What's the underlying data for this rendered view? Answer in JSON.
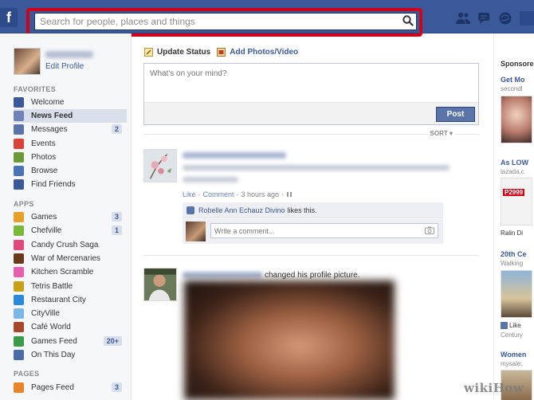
{
  "header": {
    "logo": "f",
    "search": {
      "placeholder": "Search for people, places and things",
      "value": ""
    },
    "highlight_color": "#d0021b",
    "brand_color": "#3b5998",
    "jewels": [
      "friend-requests-icon",
      "messages-icon",
      "notifications-icon"
    ]
  },
  "sidebar": {
    "edit_profile": "Edit Profile",
    "favorites_title": "FAVORITES",
    "favorites": [
      {
        "label": "Welcome",
        "icon": "facebook-icon",
        "count": ""
      },
      {
        "label": "News Feed",
        "icon": "news-feed-icon",
        "count": "",
        "active": true
      },
      {
        "label": "Messages",
        "icon": "messages-icon",
        "count": "2"
      },
      {
        "label": "Events",
        "icon": "events-icon",
        "count": ""
      },
      {
        "label": "Photos",
        "icon": "photos-icon",
        "count": ""
      },
      {
        "label": "Browse",
        "icon": "browse-icon",
        "count": ""
      },
      {
        "label": "Find Friends",
        "icon": "find-friends-icon",
        "count": ""
      }
    ],
    "apps_title": "APPS",
    "apps": [
      {
        "label": "Games",
        "icon": "games-icon",
        "count": "3"
      },
      {
        "label": "Chefville",
        "icon": "chefville-icon",
        "count": "1"
      },
      {
        "label": "Candy Crush Saga",
        "icon": "candy-crush-icon",
        "count": ""
      },
      {
        "label": "War of Mercenaries",
        "icon": "war-of-mercenaries-icon",
        "count": ""
      },
      {
        "label": "Kitchen Scramble",
        "icon": "kitchen-scramble-icon",
        "count": ""
      },
      {
        "label": "Tetris Battle",
        "icon": "tetris-battle-icon",
        "count": ""
      },
      {
        "label": "Restaurant City",
        "icon": "restaurant-city-icon",
        "count": ""
      },
      {
        "label": "CityVille",
        "icon": "cityville-icon",
        "count": ""
      },
      {
        "label": "Café World",
        "icon": "cafe-world-icon",
        "count": ""
      },
      {
        "label": "Games Feed",
        "icon": "games-feed-icon",
        "count": "20+"
      },
      {
        "label": "On This Day",
        "icon": "on-this-day-icon",
        "count": ""
      }
    ],
    "pages_title": "PAGES",
    "pages": [
      {
        "label": "Pages Feed",
        "icon": "pages-feed-icon",
        "count": "3"
      }
    ]
  },
  "composer": {
    "update_status": "Update Status",
    "add_photos": "Add Photos/Video",
    "placeholder": "What's on your mind?",
    "post_label": "Post"
  },
  "feed": {
    "sort_label": "SORT ▾",
    "post1": {
      "like": "Like",
      "sep1": "·",
      "comment": "Comment",
      "sep2": "·",
      "time": "3 hours ago",
      "sep3": "·",
      "liker_name": "Robelle Ann Echauz Divino",
      "likes_suffix": "likes this.",
      "comment_placeholder": "Write a comment..."
    },
    "post2": {
      "action": "changed his profile picture."
    }
  },
  "ads": {
    "sponsored": "Sponsored",
    "items": [
      {
        "title": "Get Mo",
        "sub": "secondl",
        "like": ""
      },
      {
        "title": "As LOW",
        "sub": "lazada.c",
        "price": "P2999",
        "like": "Ralin Di"
      },
      {
        "title": "20th Ce",
        "sub": "Walking",
        "like": "Like",
        "extra": "Century"
      },
      {
        "title": "Women",
        "sub": "mysale."
      }
    ]
  },
  "watermark": "wikiHow"
}
